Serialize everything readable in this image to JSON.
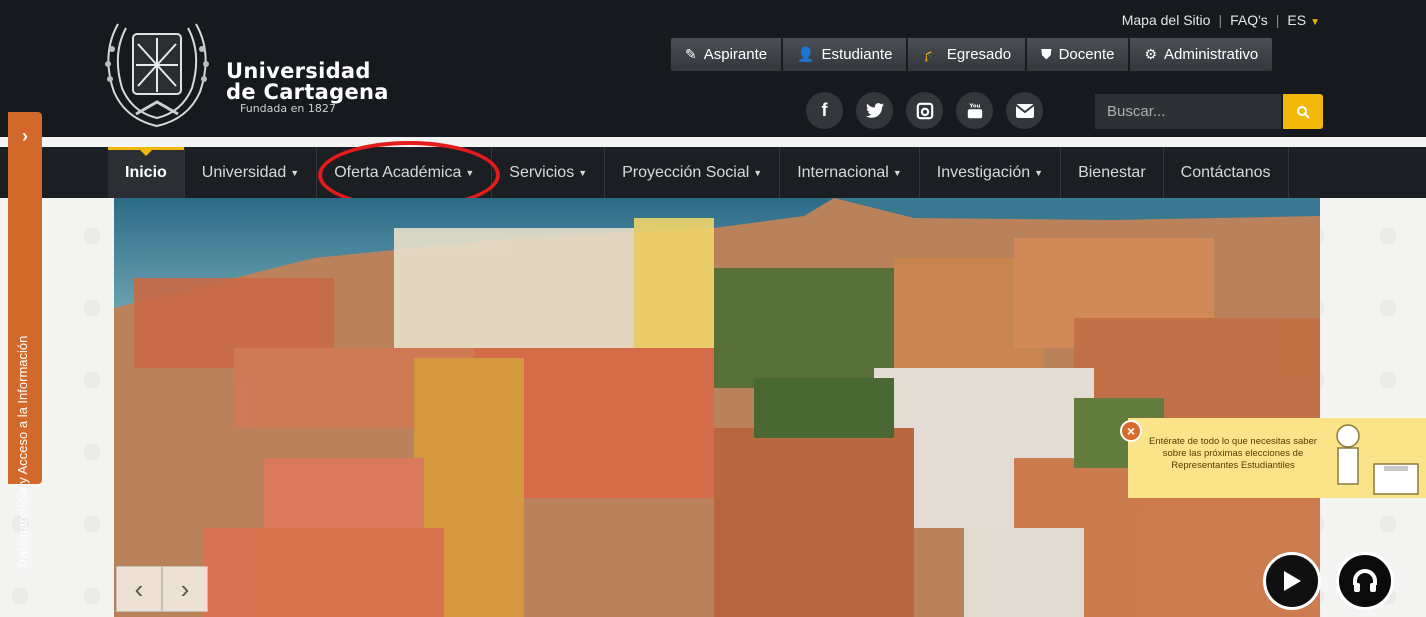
{
  "header": {
    "university_line1": "Universidad",
    "university_line2": "de Cartagena",
    "founded": "Fundada en 1827"
  },
  "top_links": {
    "site_map": "Mapa del Sitio",
    "faq": "FAQ's",
    "language": "ES"
  },
  "roles": [
    {
      "label": "Aspirante",
      "icon": "edit-icon"
    },
    {
      "label": "Estudiante",
      "icon": "user-icon"
    },
    {
      "label": "Egresado",
      "icon": "graduation-cap-icon"
    },
    {
      "label": "Docente",
      "icon": "shield-icon"
    },
    {
      "label": "Administrativo",
      "icon": "gear-icon"
    }
  ],
  "social": [
    "facebook-icon",
    "twitter-icon",
    "instagram-icon",
    "youtube-icon",
    "email-icon"
  ],
  "search": {
    "placeholder": "Buscar..."
  },
  "nav": {
    "items": [
      {
        "label": "Inicio"
      },
      {
        "label": "Universidad"
      },
      {
        "label": "Oferta Académica"
      },
      {
        "label": "Servicios"
      },
      {
        "label": "Proyección Social"
      },
      {
        "label": "Internacional"
      },
      {
        "label": "Investigación"
      },
      {
        "label": "Bienestar"
      },
      {
        "label": "Contáctanos"
      }
    ],
    "active_index": 0,
    "highlighted_index": 2
  },
  "side_tab": {
    "label": "Transparencia y Acceso a la Información"
  },
  "banner": {
    "text": "Entérate de todo lo que necesitas saber sobre las próximas elecciones de Representantes Estudiantiles"
  },
  "colors": {
    "accent": "#f2b807",
    "highlight": "#e21b1b",
    "side_tab": "#d2692a",
    "header_bg": "#16191d"
  }
}
